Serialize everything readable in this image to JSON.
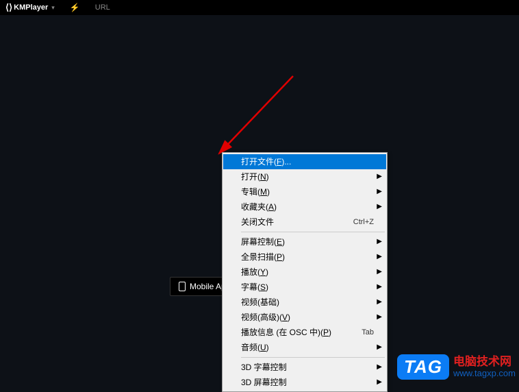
{
  "titlebar": {
    "brand": "KMPlayer",
    "url_label": "URL"
  },
  "mobile_button": {
    "label": "Mobile App"
  },
  "context_menu": {
    "items": [
      {
        "label": "打开文件(F)...",
        "mnemonic": "F",
        "shortcut": "",
        "submenu": false,
        "highlighted": true
      },
      {
        "label": "打开(N)",
        "mnemonic": "N",
        "shortcut": "",
        "submenu": true
      },
      {
        "label": "专辑(M)",
        "mnemonic": "M",
        "shortcut": "",
        "submenu": true
      },
      {
        "label": "收藏夹(A)",
        "mnemonic": "A",
        "shortcut": "",
        "submenu": true
      },
      {
        "label": "关闭文件",
        "mnemonic": "",
        "shortcut": "Ctrl+Z",
        "submenu": false
      },
      {
        "separator": true
      },
      {
        "label": "屏幕控制(E)",
        "mnemonic": "E",
        "shortcut": "",
        "submenu": true
      },
      {
        "label": "全景扫描(P)",
        "mnemonic": "P",
        "shortcut": "",
        "submenu": true
      },
      {
        "label": "播放(Y)",
        "mnemonic": "Y",
        "shortcut": "",
        "submenu": true
      },
      {
        "label": "字幕(S)",
        "mnemonic": "S",
        "shortcut": "",
        "submenu": true
      },
      {
        "label": "视频(基础)",
        "mnemonic": "",
        "shortcut": "",
        "submenu": true
      },
      {
        "label": "视频(高级)(V)",
        "mnemonic": "V",
        "shortcut": "",
        "submenu": true
      },
      {
        "label": "播放信息 (在 OSC 中)(P)",
        "mnemonic": "P",
        "shortcut": "Tab",
        "submenu": false
      },
      {
        "label": "音频(U)",
        "mnemonic": "U",
        "shortcut": "",
        "submenu": true
      },
      {
        "separator": true
      },
      {
        "label": "3D 字幕控制",
        "mnemonic": "",
        "shortcut": "",
        "submenu": true
      },
      {
        "label": "3D 屏幕控制",
        "mnemonic": "",
        "shortcut": "",
        "submenu": true
      }
    ]
  },
  "watermark": {
    "badge": "TAG",
    "title": "电脑技术网",
    "url": "www.tagxp.com"
  }
}
